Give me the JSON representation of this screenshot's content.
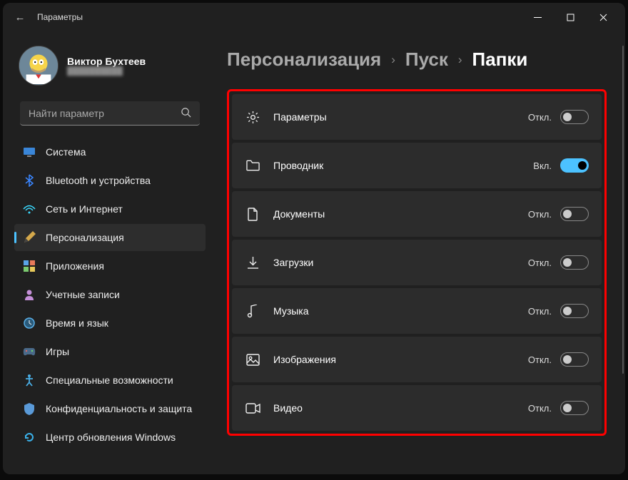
{
  "app_title": "Параметры",
  "account": {
    "name": "Виктор Бухтеев",
    "email": "██████████"
  },
  "search": {
    "placeholder": "Найти параметр"
  },
  "nav": [
    {
      "icon": "system",
      "label": "Система",
      "active": false
    },
    {
      "icon": "bluetooth",
      "label": "Bluetooth и устройства",
      "active": false
    },
    {
      "icon": "network",
      "label": "Сеть и Интернет",
      "active": false
    },
    {
      "icon": "personalization",
      "label": "Персонализация",
      "active": true
    },
    {
      "icon": "apps",
      "label": "Приложения",
      "active": false
    },
    {
      "icon": "accounts",
      "label": "Учетные записи",
      "active": false
    },
    {
      "icon": "time",
      "label": "Время и язык",
      "active": false
    },
    {
      "icon": "gaming",
      "label": "Игры",
      "active": false
    },
    {
      "icon": "accessibility",
      "label": "Специальные возможности",
      "active": false
    },
    {
      "icon": "privacy",
      "label": "Конфиденциальность и защита",
      "active": false
    },
    {
      "icon": "update",
      "label": "Центр обновления Windows",
      "active": false
    }
  ],
  "breadcrumb": {
    "level1": "Персонализация",
    "level2": "Пуск",
    "level3": "Папки"
  },
  "toggle_labels": {
    "on": "Вкл.",
    "off": "Откл."
  },
  "folders": [
    {
      "key": "settings",
      "icon": "gear",
      "label": "Параметры",
      "on": false
    },
    {
      "key": "explorer",
      "icon": "folder",
      "label": "Проводник",
      "on": true
    },
    {
      "key": "documents",
      "icon": "document",
      "label": "Документы",
      "on": false
    },
    {
      "key": "downloads",
      "icon": "download",
      "label": "Загрузки",
      "on": false
    },
    {
      "key": "music",
      "icon": "music",
      "label": "Музыка",
      "on": false
    },
    {
      "key": "pictures",
      "icon": "image",
      "label": "Изображения",
      "on": false
    },
    {
      "key": "videos",
      "icon": "video",
      "label": "Видео",
      "on": false
    }
  ]
}
